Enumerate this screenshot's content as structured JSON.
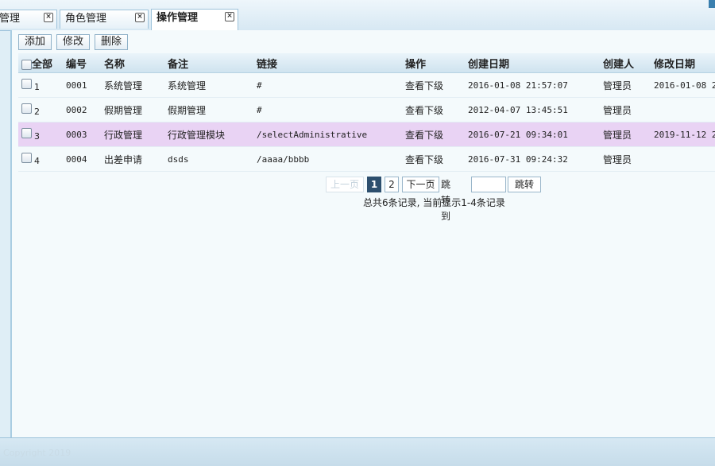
{
  "tabs": [
    {
      "label": "管理",
      "active": false
    },
    {
      "label": "角色管理",
      "active": false
    },
    {
      "label": "操作管理",
      "active": true
    }
  ],
  "toolbar": {
    "add_label": "添加",
    "edit_label": "修改",
    "delete_label": "删除"
  },
  "table": {
    "headers": {
      "select_all": "全部",
      "code": "编号",
      "name": "名称",
      "remark": "备注",
      "link": "链接",
      "action": "操作",
      "created": "创建日期",
      "creator": "创建人",
      "modified": "修改日期"
    },
    "rows": [
      {
        "num": "1",
        "code": "0001",
        "name": "系统管理",
        "remark": "系统管理",
        "link": "#",
        "action": "查看下级",
        "created": "2016-01-08 21:57:07",
        "creator": "管理员",
        "modified": "2016-01-08 2"
      },
      {
        "num": "2",
        "code": "0002",
        "name": "假期管理",
        "remark": "假期管理",
        "link": "#",
        "action": "查看下级",
        "created": "2012-04-07 13:45:51",
        "creator": "管理员",
        "modified": ""
      },
      {
        "num": "3",
        "code": "0003",
        "name": "行政管理",
        "remark": "行政管理模块",
        "link": "/selectAdministrative",
        "action": "查看下级",
        "created": "2016-07-21 09:34:01",
        "creator": "管理员",
        "modified": "2019-11-12 2"
      },
      {
        "num": "4",
        "code": "0004",
        "name": "出差申请",
        "remark": "dsds",
        "link": "/aaaa/bbbb",
        "action": "查看下级",
        "created": "2016-07-31 09:24:32",
        "creator": "管理员",
        "modified": ""
      }
    ]
  },
  "pager": {
    "prev_label": "上一页",
    "page1": "1",
    "page2": "2",
    "next_label": "下一页",
    "goto_label": "跳转到",
    "goto_button": "跳转",
    "info": "总共6条记录, 当前显示1-4条记录"
  },
  "status": {
    "copyright": "Copyright 2019"
  },
  "colors": {
    "selected_row": "#e9d3f4",
    "current_page": "#2d4f6e",
    "accent": "#9ec3db"
  }
}
